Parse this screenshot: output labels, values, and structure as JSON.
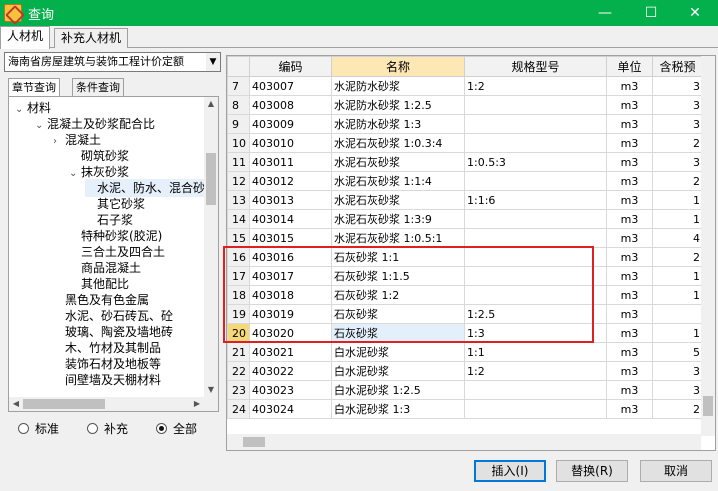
{
  "window": {
    "title": "查询"
  },
  "tabs": [
    "人材机",
    "补充人材机"
  ],
  "left": {
    "quota_select": "海南省房屋建筑与装饰工程计价定额",
    "subtabs": [
      "章节查询",
      "条件查询"
    ],
    "tree": [
      {
        "label": "材料",
        "toggle": "⌄"
      },
      {
        "label": "混凝土及砂浆配合比",
        "toggle": "⌄"
      },
      {
        "label": "混凝土",
        "toggle": "›"
      },
      {
        "label": "砌筑砂浆",
        "toggle": ""
      },
      {
        "label": "抹灰砂浆",
        "toggle": "⌄"
      },
      {
        "label": "水泥、防水、混合砂",
        "toggle": ""
      },
      {
        "label": "其它砂浆",
        "toggle": ""
      },
      {
        "label": "石子浆",
        "toggle": ""
      },
      {
        "label": "特种砂浆(胶泥)",
        "toggle": ""
      },
      {
        "label": "三合土及四合土",
        "toggle": ""
      },
      {
        "label": "商品混凝土",
        "toggle": ""
      },
      {
        "label": "其他配比",
        "toggle": ""
      },
      {
        "label": "黑色及有色金属",
        "toggle": ""
      },
      {
        "label": "水泥、砂石砖瓦、砼",
        "toggle": ""
      },
      {
        "label": "玻璃、陶瓷及墙地砖",
        "toggle": ""
      },
      {
        "label": "木、竹材及其制品",
        "toggle": ""
      },
      {
        "label": "装饰石材及地板等",
        "toggle": ""
      },
      {
        "label": "间壁墙及天棚材料",
        "toggle": ""
      }
    ],
    "radios": [
      {
        "label": "标准",
        "checked": false
      },
      {
        "label": "补充",
        "checked": false
      },
      {
        "label": "全部",
        "checked": true
      }
    ]
  },
  "grid": {
    "columns": [
      "",
      "编码",
      "名称",
      "规格型号",
      "单位",
      "含税预"
    ],
    "rows": [
      {
        "no": "7",
        "code": "403007",
        "name": "水泥防水砂浆",
        "spec": "1:2",
        "unit": "m3",
        "price": "3"
      },
      {
        "no": "8",
        "code": "403008",
        "name": "水泥防水砂浆 1:2.5",
        "spec": "",
        "unit": "m3",
        "price": "3"
      },
      {
        "no": "9",
        "code": "403009",
        "name": "水泥防水砂浆 1:3",
        "spec": "",
        "unit": "m3",
        "price": "3"
      },
      {
        "no": "10",
        "code": "403010",
        "name": "水泥石灰砂浆 1:0.3:4",
        "spec": "",
        "unit": "m3",
        "price": "2"
      },
      {
        "no": "11",
        "code": "403011",
        "name": "水泥石灰砂浆",
        "spec": "1:0.5:3",
        "unit": "m3",
        "price": "3"
      },
      {
        "no": "12",
        "code": "403012",
        "name": "水泥石灰砂浆 1:1:4",
        "spec": "",
        "unit": "m3",
        "price": "2"
      },
      {
        "no": "13",
        "code": "403013",
        "name": "水泥石灰砂浆",
        "spec": "1:1:6",
        "unit": "m3",
        "price": "1"
      },
      {
        "no": "14",
        "code": "403014",
        "name": "水泥石灰砂浆 1:3:9",
        "spec": "",
        "unit": "m3",
        "price": "1"
      },
      {
        "no": "15",
        "code": "403015",
        "name": "水泥石灰砂浆 1:0.5:1",
        "spec": "",
        "unit": "m3",
        "price": "4"
      },
      {
        "no": "16",
        "code": "403016",
        "name": "石灰砂浆 1:1",
        "spec": "",
        "unit": "m3",
        "price": "2"
      },
      {
        "no": "17",
        "code": "403017",
        "name": "石灰砂浆 1:1.5",
        "spec": "",
        "unit": "m3",
        "price": "1"
      },
      {
        "no": "18",
        "code": "403018",
        "name": "石灰砂浆 1:2",
        "spec": "",
        "unit": "m3",
        "price": "1"
      },
      {
        "no": "19",
        "code": "403019",
        "name": "石灰砂浆",
        "spec": "1:2.5",
        "unit": "m3",
        "price": ""
      },
      {
        "no": "20",
        "code": "403020",
        "name": "石灰砂浆",
        "spec": "1:3",
        "unit": "m3",
        "price": "1"
      },
      {
        "no": "21",
        "code": "403021",
        "name": "白水泥砂浆",
        "spec": "1:1",
        "unit": "m3",
        "price": "5"
      },
      {
        "no": "22",
        "code": "403022",
        "name": "白水泥砂浆",
        "spec": "1:2",
        "unit": "m3",
        "price": "3"
      },
      {
        "no": "23",
        "code": "403023",
        "name": "白水泥砂浆 1:2.5",
        "spec": "",
        "unit": "m3",
        "price": "3"
      },
      {
        "no": "24",
        "code": "403024",
        "name": "白水泥砂浆 1:3",
        "spec": "",
        "unit": "m3",
        "price": "2"
      }
    ]
  },
  "buttons": {
    "insert": "插入(I)",
    "replace": "替换(R)",
    "cancel": "取消"
  },
  "colors": {
    "titlebar": "#04b04b",
    "highlight": "#e02020",
    "selected_row_no": "#f4d879"
  }
}
